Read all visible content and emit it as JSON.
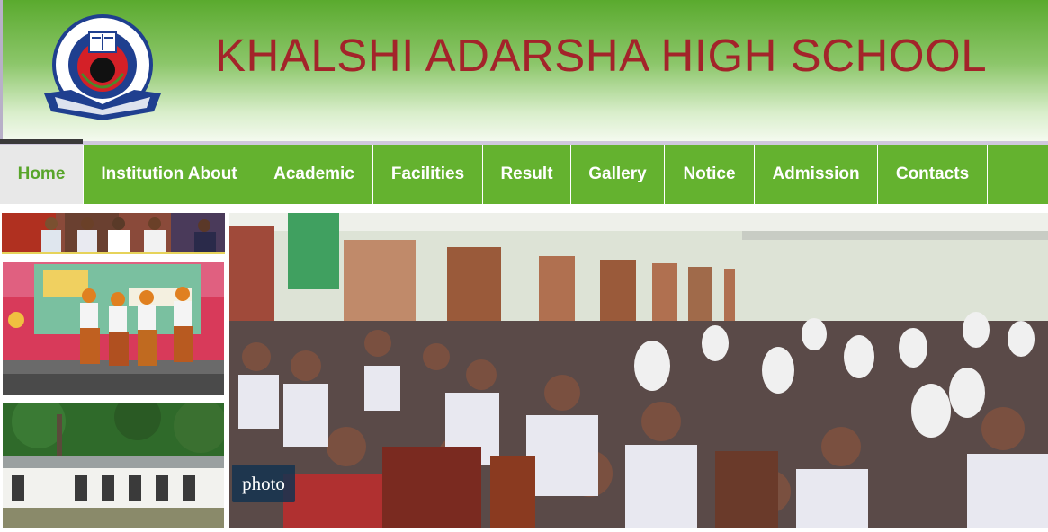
{
  "header": {
    "title": "KHALSHI ADARSHA HIGH SCHOOL",
    "logo_icon": "education-board-seal-icon",
    "title_color": "#a3242a"
  },
  "nav": {
    "items": [
      {
        "label": "Home",
        "active": true
      },
      {
        "label": "Institution About"
      },
      {
        "label": "Academic"
      },
      {
        "label": "Facilities"
      },
      {
        "label": "Result"
      },
      {
        "label": "Gallery"
      },
      {
        "label": "Notice"
      },
      {
        "label": "Admission"
      },
      {
        "label": "Contacts"
      }
    ],
    "color": "#64b22f"
  },
  "slideshow": {
    "caption": "photo"
  }
}
